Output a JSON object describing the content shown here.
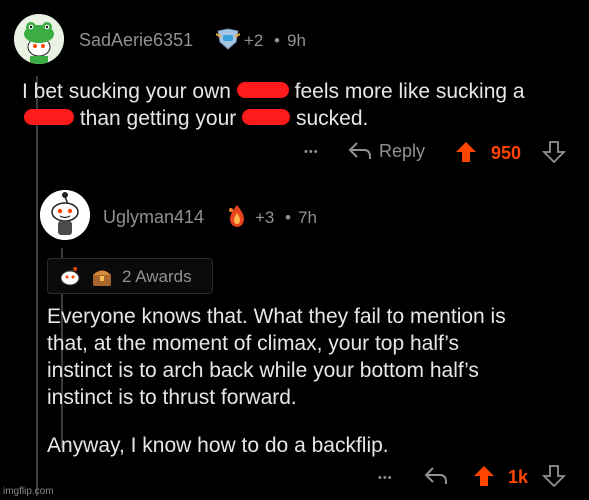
{
  "comment1": {
    "username": "SadAerie6351",
    "score_badge": "+2",
    "separator": "•",
    "time": "9h",
    "line1_a": "I bet sucking your own",
    "line1_b": "feels more like sucking a",
    "line2_a": "than getting your",
    "line2_b": "sucked.",
    "more": "•••",
    "reply_label": "Reply",
    "votes": "950",
    "avatar_icon": "frog-hat-snoo-icon",
    "flair_icon": "shield-flair-icon"
  },
  "comment2": {
    "username": "Uglyman414",
    "score_badge": "+3",
    "separator": "•",
    "time": "7h",
    "awards_label": "2 Awards",
    "paragraph1": [
      "Everyone knows that. What they fail to mention is",
      "that, at the moment of climax, your top half’s",
      "instinct is to arch back while your bottom half’s",
      "instinct is to thrust forward."
    ],
    "paragraph2": "Anyway, I know how to do a backflip.",
    "more": "•••",
    "votes": "1k",
    "avatar_icon": "snoo-avatar-icon",
    "flair_icon": "flame-flair-icon"
  },
  "watermark": "imgflip.com",
  "colors": {
    "background": "#000000",
    "upvote": "#ff4500",
    "meta": "#8e9296",
    "redaction": "#ff1b1b"
  }
}
